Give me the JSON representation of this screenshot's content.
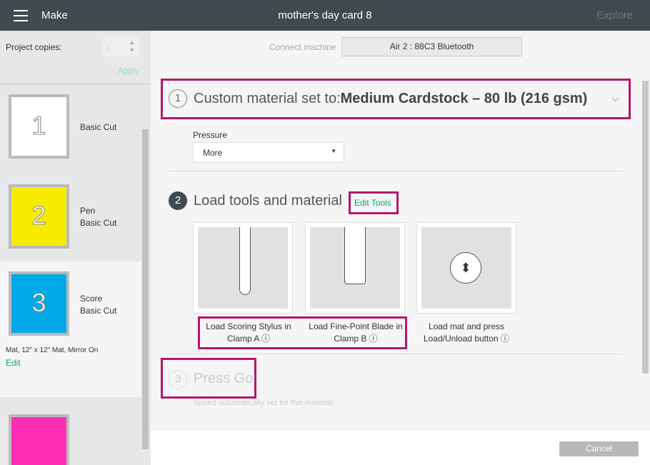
{
  "header": {
    "menu_label": "Make",
    "title": "mother's day card 8",
    "explore": "Explore"
  },
  "sidebar": {
    "copies_label": "Project copies:",
    "copies_value": "1",
    "apply": "Apply",
    "mats": [
      {
        "num": "1",
        "lines": [
          "Basic Cut"
        ],
        "color": "#ffffff"
      },
      {
        "num": "2",
        "lines": [
          "Pen",
          "Basic Cut"
        ],
        "color": "#f5ec00"
      },
      {
        "num": "3",
        "lines": [
          "Score",
          "Basic Cut"
        ],
        "color": "#00a9e8"
      },
      {
        "num": "",
        "lines": [],
        "color": "#ff2db4"
      }
    ],
    "selected_info": "Mat, 12\" x 12\" Mat, Mirror On",
    "edit": "Edit"
  },
  "main": {
    "connect_label": "Connect machine",
    "machine": "Air 2 : 88C3 Bluetooth",
    "step1": {
      "num": "1",
      "prefix": "Custom material set to:",
      "material": "Medium Cardstock – 80 lb (216 gsm)"
    },
    "pressure_label": "Pressure",
    "pressure_value": "More",
    "step2": {
      "num": "2",
      "title": "Load tools and material",
      "edit_tools": "Edit Tools"
    },
    "cards": [
      {
        "l1": "Load Scoring Stylus in",
        "l2": "Clamp A"
      },
      {
        "l1": "Load Fine-Point Blade in",
        "l2": "Clamp B"
      },
      {
        "l1": "Load mat and press",
        "l2": "Load/Unload button"
      }
    ],
    "step3": {
      "num": "3",
      "title": "Press Go",
      "note": "Speed automatically set for this material."
    }
  },
  "footer": {
    "cancel": "Cancel"
  },
  "colors": {
    "highlight": "#b5166b",
    "accent": "#00a878",
    "header": "#414a4f"
  }
}
